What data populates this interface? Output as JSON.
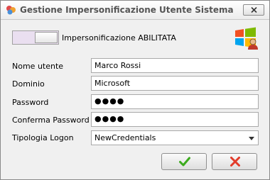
{
  "window": {
    "title": "Gestione Impersonificazione Utente Sistema"
  },
  "toggle": {
    "label": "Impersonificazione ABILITATA",
    "enabled": true
  },
  "form": {
    "username": {
      "label": "Nome utente",
      "value": "Marco Rossi"
    },
    "domain": {
      "label": "Dominio",
      "value": "Microsoft"
    },
    "password": {
      "label": "Password",
      "value": "●●●●"
    },
    "confirm_password": {
      "label": "Conferma Password",
      "value": "●●●●"
    },
    "logon_type": {
      "label": "Tipologia Logon",
      "value": "NewCredentials"
    }
  },
  "colors": {
    "ok_icon": "#3cab1e",
    "cancel_icon": "#e23b2a",
    "toggle_track": "#eadff0"
  },
  "icons": {
    "app": "impersonation-app-icon",
    "close": "close-icon",
    "logo": "windows-user-logo-icon",
    "ok": "checkmark-icon",
    "cancel": "cancel-x-icon",
    "dropdown": "chevron-down-icon"
  }
}
